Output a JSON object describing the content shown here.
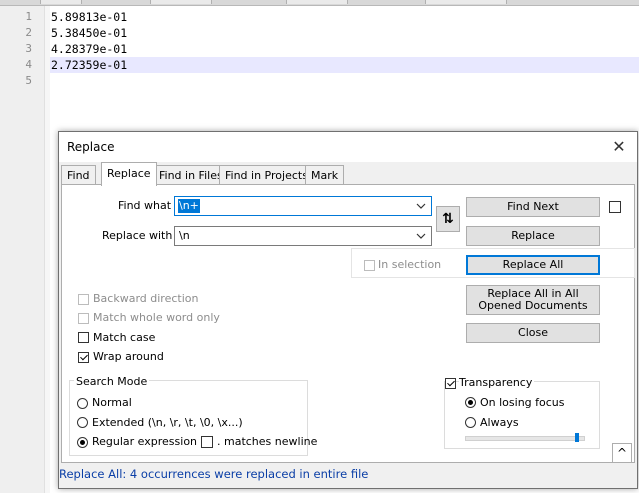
{
  "editor": {
    "line_numbers": [
      "1",
      "2",
      "3",
      "4",
      "5"
    ],
    "lines": [
      "5.89813e-01",
      "5.38450e-01",
      "4.28379e-01",
      "2.72359e-01",
      ""
    ],
    "current_line_index": 3
  },
  "dialog": {
    "title": "Replace",
    "close_glyph": "✕",
    "tabs": [
      "Find",
      "Replace",
      "Find in Files",
      "Find in Projects",
      "Mark"
    ],
    "active_tab": "Replace",
    "find_what_label": "Find what :",
    "find_what_value": "\\n+",
    "replace_with_label": "Replace with :",
    "replace_with_value": "\\n",
    "swap_glyph": "⇅",
    "buttons": {
      "find_next": "Find Next",
      "replace": "Replace",
      "replace_all": "Replace All",
      "replace_all_opened": "Replace All in All Opened Documents",
      "close": "Close"
    },
    "in_selection": {
      "label": "In selection",
      "checked": false,
      "enabled": false
    },
    "options": [
      {
        "label": "Backward direction",
        "checked": false,
        "enabled": false
      },
      {
        "label": "Match whole word only",
        "checked": false,
        "enabled": false
      },
      {
        "label": "Match case",
        "checked": false,
        "enabled": true
      },
      {
        "label": "Wrap around",
        "checked": true,
        "enabled": true
      }
    ],
    "search_mode": {
      "title": "Search Mode",
      "options": [
        "Normal",
        "Extended (\\n, \\r, \\t, \\0, \\x...)",
        "Regular expression"
      ],
      "selected": "Regular expression",
      "matches_newline_label": ". matches newline",
      "matches_newline_checked": false
    },
    "transparency": {
      "label": "Transparency",
      "checked": true,
      "options": [
        "On losing focus",
        "Always"
      ],
      "selected": "On losing focus",
      "slider_value": 0.95
    },
    "collapse_glyph": "^",
    "status_text": "Replace All: 4 occurrences were replaced in entire file"
  },
  "colors": {
    "accent": "#0078d7",
    "current_line": "#e8e8ff",
    "status_text": "#0a3ea6"
  }
}
